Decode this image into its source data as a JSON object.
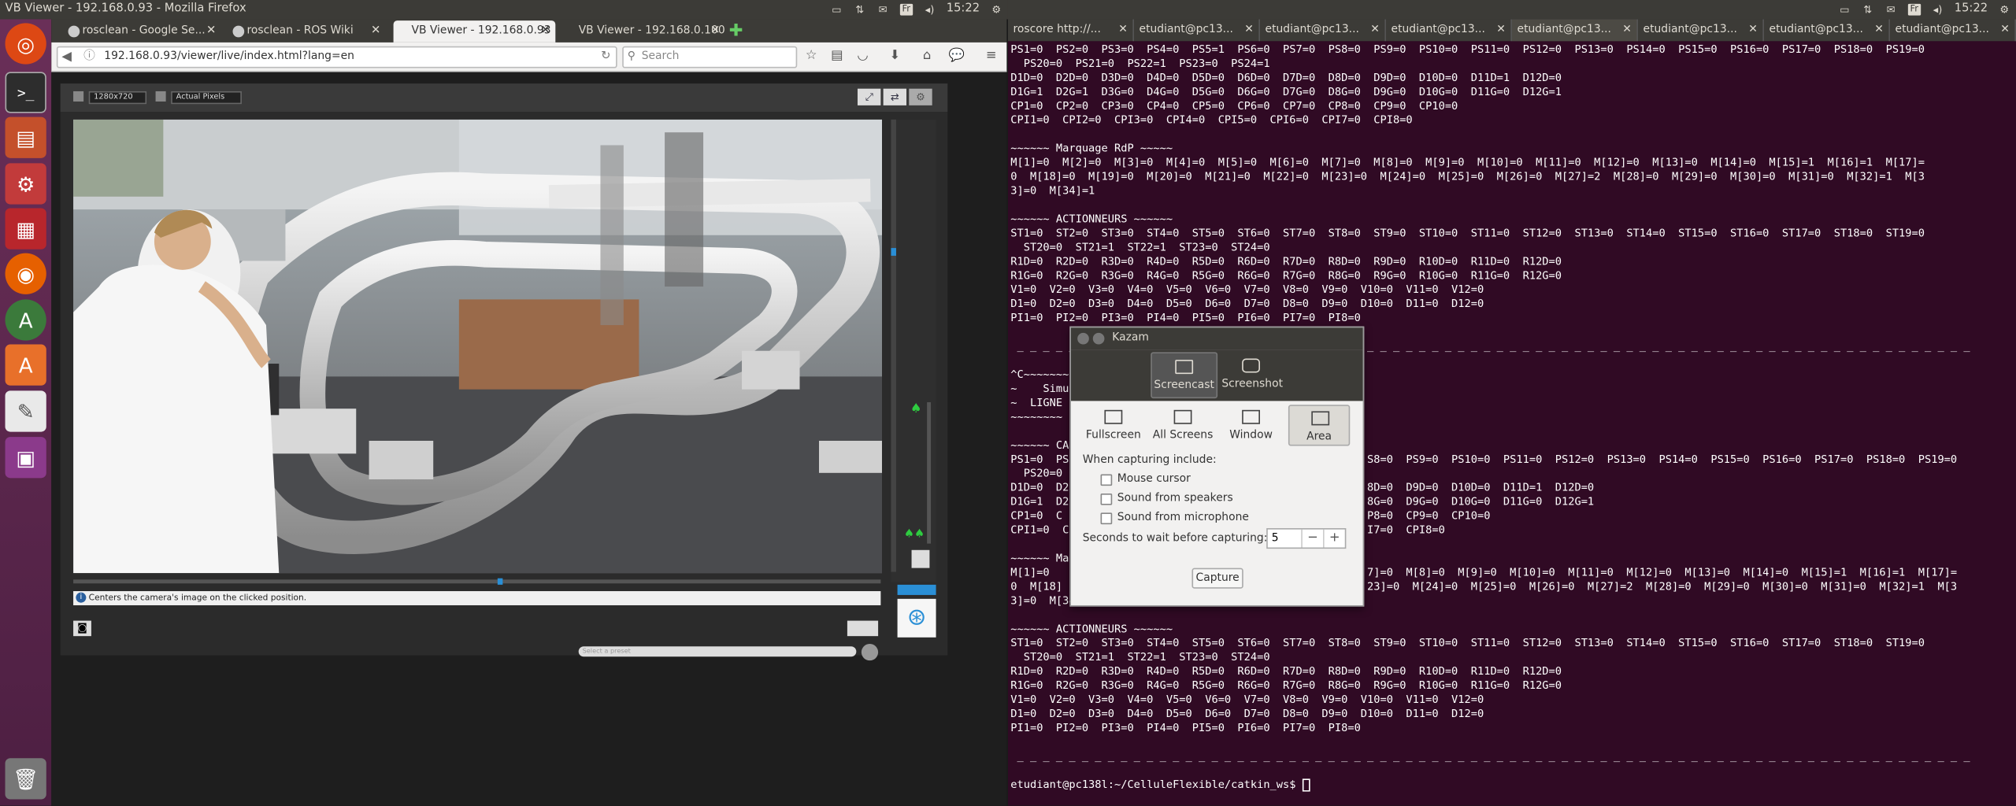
{
  "top_panel": {
    "window_title": "VB Viewer - 192.168.0.93 - Mozilla Firefox",
    "keyboard_layout": "Fr",
    "clock": "15:22",
    "tray_icons": [
      "video-icon",
      "transfer-icon",
      "mail-icon",
      "keyboard-layout",
      "volume-icon",
      "clock",
      "gear-icon"
    ]
  },
  "launcher": {
    "items": [
      "ubuntu-dash-icon",
      "terminal-icon",
      "files-icon",
      "settings-icon",
      "presentation-icon",
      "firefox-icon",
      "font-tool-icon",
      "software-center-icon",
      "text-editor-icon",
      "screen-recorder-icon",
      "trash-icon"
    ]
  },
  "firefox": {
    "tabs": [
      {
        "label": "rosclean - Google Se...",
        "active": false
      },
      {
        "label": "rosclean - ROS Wiki",
        "active": false
      },
      {
        "label": "VB Viewer - 192.168.0.93",
        "active": true
      },
      {
        "label": "VB Viewer - 192.168.0.100",
        "active": false
      }
    ],
    "url": "192.168.0.93/viewer/live/index.html?lang=en",
    "search_placeholder": "Search",
    "viewer": {
      "resolution_select": "1280x720",
      "preset_select": "Actual Pixels",
      "status_text": "Centers the camera's image on the clicked position.",
      "preset_placeholder": "Select a preset"
    }
  },
  "terminal": {
    "tabs": [
      "roscore http://...",
      "etudiant@pc13...",
      "etudiant@pc13...",
      "etudiant@pc13...",
      "etudiant@pc13...",
      "etudiant@pc13...",
      "etudiant@pc13...",
      "etudiant@pc13..."
    ],
    "active_tab": 4,
    "lines": [
      "PS1=0  PS2=0  PS3=0  PS4=0  PS5=1  PS6=0  PS7=0  PS8=0  PS9=0  PS10=0  PS11=0  PS12=0  PS13=0  PS14=0  PS15=0  PS16=0  PS17=0  PS18=0  PS19=0",
      "  PS20=0  PS21=0  PS22=1  PS23=0  PS24=1",
      "D1D=0  D2D=0  D3D=0  D4D=0  D5D=0  D6D=0  D7D=0  D8D=0  D9D=0  D10D=0  D11D=1  D12D=0",
      "D1G=1  D2G=1  D3G=0  D4G=0  D5G=0  D6G=0  D7G=0  D8G=0  D9G=0  D10G=0  D11G=0  D12G=1",
      "CP1=0  CP2=0  CP3=0  CP4=0  CP5=0  CP6=0  CP7=0  CP8=0  CP9=0  CP10=0",
      "CPI1=0  CPI2=0  CPI3=0  CPI4=0  CPI5=0  CPI6=0  CPI7=0  CPI8=0",
      "",
      "~~~~~~ Marquage RdP ~~~~~",
      "M[1]=0  M[2]=0  M[3]=0  M[4]=0  M[5]=0  M[6]=0  M[7]=0  M[8]=0  M[9]=0  M[10]=0  M[11]=0  M[12]=0  M[13]=0  M[14]=0  M[15]=1  M[16]=1  M[17]=",
      "0  M[18]=0  M[19]=0  M[20]=0  M[21]=0  M[22]=0  M[23]=0  M[24]=0  M[25]=0  M[26]=0  M[27]=2  M[28]=0  M[29]=0  M[30]=0  M[31]=0  M[32]=1  M[3",
      "3]=0  M[34]=1",
      "",
      "~~~~~~ ACTIONNEURS ~~~~~~",
      "ST1=0  ST2=0  ST3=0  ST4=0  ST5=0  ST6=0  ST7=0  ST8=0  ST9=0  ST10=0  ST11=0  ST12=0  ST13=0  ST14=0  ST15=0  ST16=0  ST17=0  ST18=0  ST19=0",
      "  ST20=0  ST21=1  ST22=1  ST23=0  ST24=0",
      "R1D=0  R2D=0  R3D=0  R4D=0  R5D=0  R6D=0  R7D=0  R8D=0  R9D=0  R10D=0  R11D=0  R12D=0",
      "R1G=0  R2G=0  R3G=0  R4G=0  R5G=0  R6G=0  R7G=0  R8G=0  R9G=0  R10G=0  R11G=0  R12G=0",
      "V1=0  V2=0  V3=0  V4=0  V5=0  V6=0  V7=0  V8=0  V9=0  V10=0  V11=0  V12=0",
      "D1=0  D2=0  D3=0  D4=0  D5=0  D6=0  D7=0  D8=0  D9=0  D10=0  D11=0  D12=0",
      "PI1=0  PI2=0  PI3=0  PI4=0  PI5=0  PI6=0  PI7=0  PI8=0",
      "",
      " _ _ _ _ _ _ _ _ _ _ _ _ _ _ _ _ _ _ _ _ _ _ _ _ _ _ _ _ _ _ _ _ _ _ _ _ _ _ _ _ _ _ _ _ _ _ _ _ _ _ _ _ _ _ _ _ _ _ _ _ _ _ _ _ _ _ _ _ _ _ _ _ _ _",
      "",
      "^C~~~~~~~",
      "~    Simu",
      "~  LIGNE",
      "~~~~~~~~",
      "",
      "~~~~~~ CA",
      "PS1=0  PS                                              S8=0  PS9=0  PS10=0  PS11=0  PS12=0  PS13=0  PS14=0  PS15=0  PS16=0  PS17=0  PS18=0  PS19=0",
      "  PS20=0",
      "D1D=0  D2                                              8D=0  D9D=0  D10D=0  D11D=1  D12D=0",
      "D1G=1  D2                                              8G=0  D9G=0  D10G=0  D11G=0  D12G=1",
      "CP1=0  C                                               P8=0  CP9=0  CP10=0",
      "CPI1=0  C                                              I7=0  CPI8=0",
      "",
      "~~~~~~ Ma",
      "M[1]=0                                                 7]=0  M[8]=0  M[9]=0  M[10]=0  M[11]=0  M[12]=0  M[13]=0  M[14]=0  M[15]=1  M[16]=1  M[17]=",
      "0  M[18]                                               23]=0  M[24]=0  M[25]=0  M[26]=0  M[27]=2  M[28]=0  M[29]=0  M[30]=0  M[31]=0  M[32]=1  M[3",
      "3]=0  M[34]=1",
      "",
      "~~~~~~ ACTIONNEURS ~~~~~~",
      "ST1=0  ST2=0  ST3=0  ST4=0  ST5=0  ST6=0  ST7=0  ST8=0  ST9=0  ST10=0  ST11=0  ST12=0  ST13=0  ST14=0  ST15=0  ST16=0  ST17=0  ST18=0  ST19=0",
      "  ST20=0  ST21=1  ST22=1  ST23=0  ST24=0",
      "R1D=0  R2D=0  R3D=0  R4D=0  R5D=0  R6D=0  R7D=0  R8D=0  R9D=0  R10D=0  R11D=0  R12D=0",
      "R1G=0  R2G=0  R3G=0  R4G=0  R5G=0  R6G=0  R7G=0  R8G=0  R9G=0  R10G=0  R11G=0  R12G=0",
      "V1=0  V2=0  V3=0  V4=0  V5=0  V6=0  V7=0  V8=0  V9=0  V10=0  V11=0  V12=0",
      "D1=0  D2=0  D3=0  D4=0  D5=0  D6=0  D7=0  D8=0  D9=0  D10=0  D11=0  D12=0",
      "PI1=0  PI2=0  PI3=0  PI4=0  PI5=0  PI6=0  PI7=0  PI8=0",
      "",
      " _ _ _ _ _ _ _ _ _ _ _ _ _ _ _ _ _ _ _ _ _ _ _ _ _ _ _ _ _ _ _ _ _ _ _ _ _ _ _ _ _ _ _ _ _ _ _ _ _ _ _ _ _ _ _ _ _ _ _ _ _ _ _ _ _ _ _ _ _ _ _ _ _ _",
      ""
    ],
    "prompt": "etudiant@pc138l:~/CelluleFlexible/catkin_ws$ "
  },
  "kazam": {
    "title": "Kazam",
    "modes": [
      {
        "label": "Screencast",
        "selected": true
      },
      {
        "label": "Screenshot",
        "selected": false
      }
    ],
    "sources": [
      {
        "label": "Fullscreen",
        "selected": false
      },
      {
        "label": "All Screens",
        "selected": false
      },
      {
        "label": "Window",
        "selected": false
      },
      {
        "label": "Area",
        "selected": true
      }
    ],
    "include_label": "When capturing include:",
    "options": [
      {
        "label": "Mouse cursor",
        "checked": false
      },
      {
        "label": "Sound from speakers",
        "checked": false
      },
      {
        "label": "Sound from microphone",
        "checked": false
      }
    ],
    "delay_label": "Seconds to wait before capturing:",
    "delay_value": "5",
    "capture_label": "Capture"
  },
  "colors": {
    "terminal_bg": "#300a24",
    "panel_bg": "#3c3b37",
    "launcher_bg": "#5e2750"
  }
}
